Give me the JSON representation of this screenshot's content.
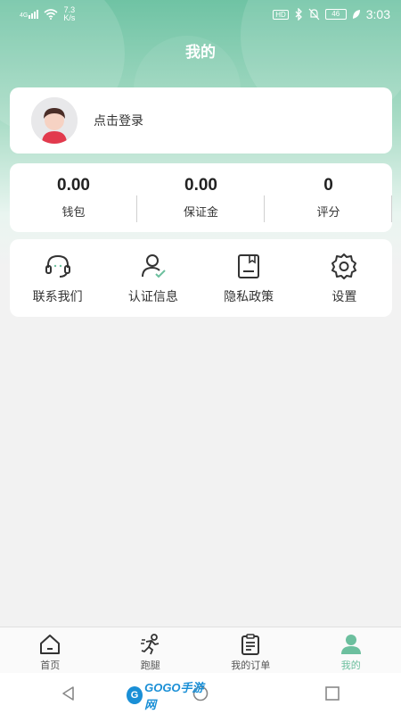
{
  "status_bar": {
    "signal": "4G",
    "net_speed_value": "7.3",
    "net_speed_unit": "K/s",
    "hd_badge": "HD",
    "battery": "46",
    "time": "3:03"
  },
  "header": {
    "title": "我的"
  },
  "login": {
    "label": "点击登录"
  },
  "stats": [
    {
      "value": "0.00",
      "label": "钱包"
    },
    {
      "value": "0.00",
      "label": "保证金"
    },
    {
      "value": "0",
      "label": "评分"
    }
  ],
  "menu": [
    {
      "label": "联系我们",
      "icon": "headset-icon"
    },
    {
      "label": "认证信息",
      "icon": "user-verified-icon"
    },
    {
      "label": "隐私政策",
      "icon": "document-icon"
    },
    {
      "label": "设置",
      "icon": "gear-icon"
    }
  ],
  "tabs": [
    {
      "label": "首页",
      "icon": "home-icon"
    },
    {
      "label": "跑腿",
      "icon": "runner-icon"
    },
    {
      "label": "我的订单",
      "icon": "clipboard-icon"
    },
    {
      "label": "我的",
      "icon": "profile-icon",
      "active": true
    }
  ],
  "watermark": {
    "ball": "G",
    "text": "GOGO手游网"
  },
  "colors": {
    "accent": "#6cbf9e",
    "header": "#6fc3a4"
  }
}
